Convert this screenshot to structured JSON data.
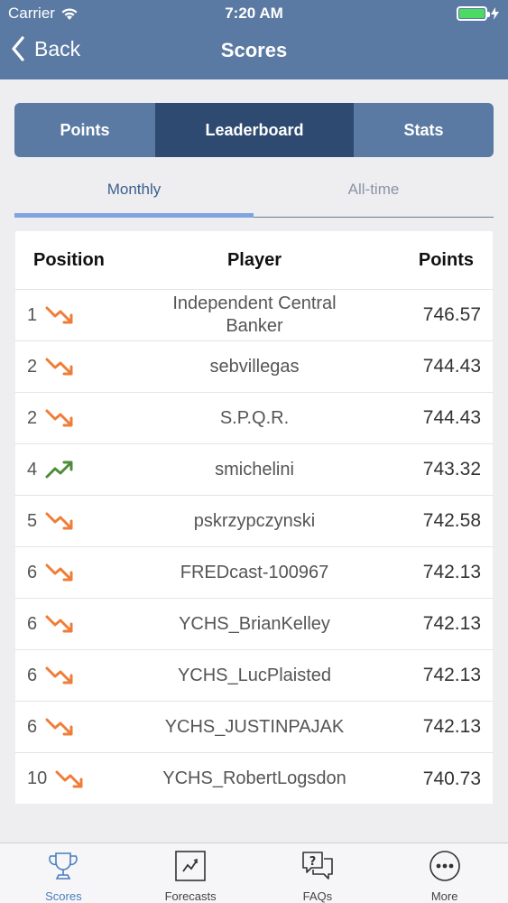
{
  "status_bar": {
    "carrier": "Carrier",
    "time": "7:20 AM",
    "battery_color": "#4cd964"
  },
  "nav": {
    "back_label": "Back",
    "title": "Scores"
  },
  "segments": {
    "items": [
      "Points",
      "Leaderboard",
      "Stats"
    ],
    "selected": "Leaderboard"
  },
  "subtabs": {
    "items": [
      "Monthly",
      "All-time"
    ],
    "selected": "Monthly"
  },
  "table": {
    "headers": [
      "Position",
      "Player",
      "Points"
    ],
    "rows": [
      {
        "position": "1",
        "trend": "down",
        "player": "Independent Central Banker",
        "points": "746.57"
      },
      {
        "position": "2",
        "trend": "down",
        "player": "sebvillegas",
        "points": "744.43"
      },
      {
        "position": "2",
        "trend": "down",
        "player": "S.P.Q.R.",
        "points": "744.43"
      },
      {
        "position": "4",
        "trend": "up",
        "player": "smichelini",
        "points": "743.32"
      },
      {
        "position": "5",
        "trend": "down",
        "player": "pskrzypczynski",
        "points": "742.58"
      },
      {
        "position": "6",
        "trend": "down",
        "player": "FREDcast-100967",
        "points": "742.13"
      },
      {
        "position": "6",
        "trend": "down",
        "player": "YCHS_BrianKelley",
        "points": "742.13"
      },
      {
        "position": "6",
        "trend": "down",
        "player": "YCHS_LucPlaisted",
        "points": "742.13"
      },
      {
        "position": "6",
        "trend": "down",
        "player": "YCHS_JUSTINPAJAK",
        "points": "742.13"
      },
      {
        "position": "10",
        "trend": "down",
        "player": "YCHS_RobertLogsdon",
        "points": "740.73"
      }
    ]
  },
  "tabbar": {
    "items": [
      {
        "label": "Scores",
        "icon": "trophy-icon"
      },
      {
        "label": "Forecasts",
        "icon": "chart-icon"
      },
      {
        "label": "FAQs",
        "icon": "faq-icon"
      },
      {
        "label": "More",
        "icon": "more-icon"
      }
    ],
    "selected": "Scores"
  },
  "colors": {
    "header": "#5b7aa3",
    "segment_selected": "#2f4a70",
    "trend_down": "#ef7d37",
    "trend_up": "#4e8c3a",
    "tab_active": "#4a7dc0"
  }
}
